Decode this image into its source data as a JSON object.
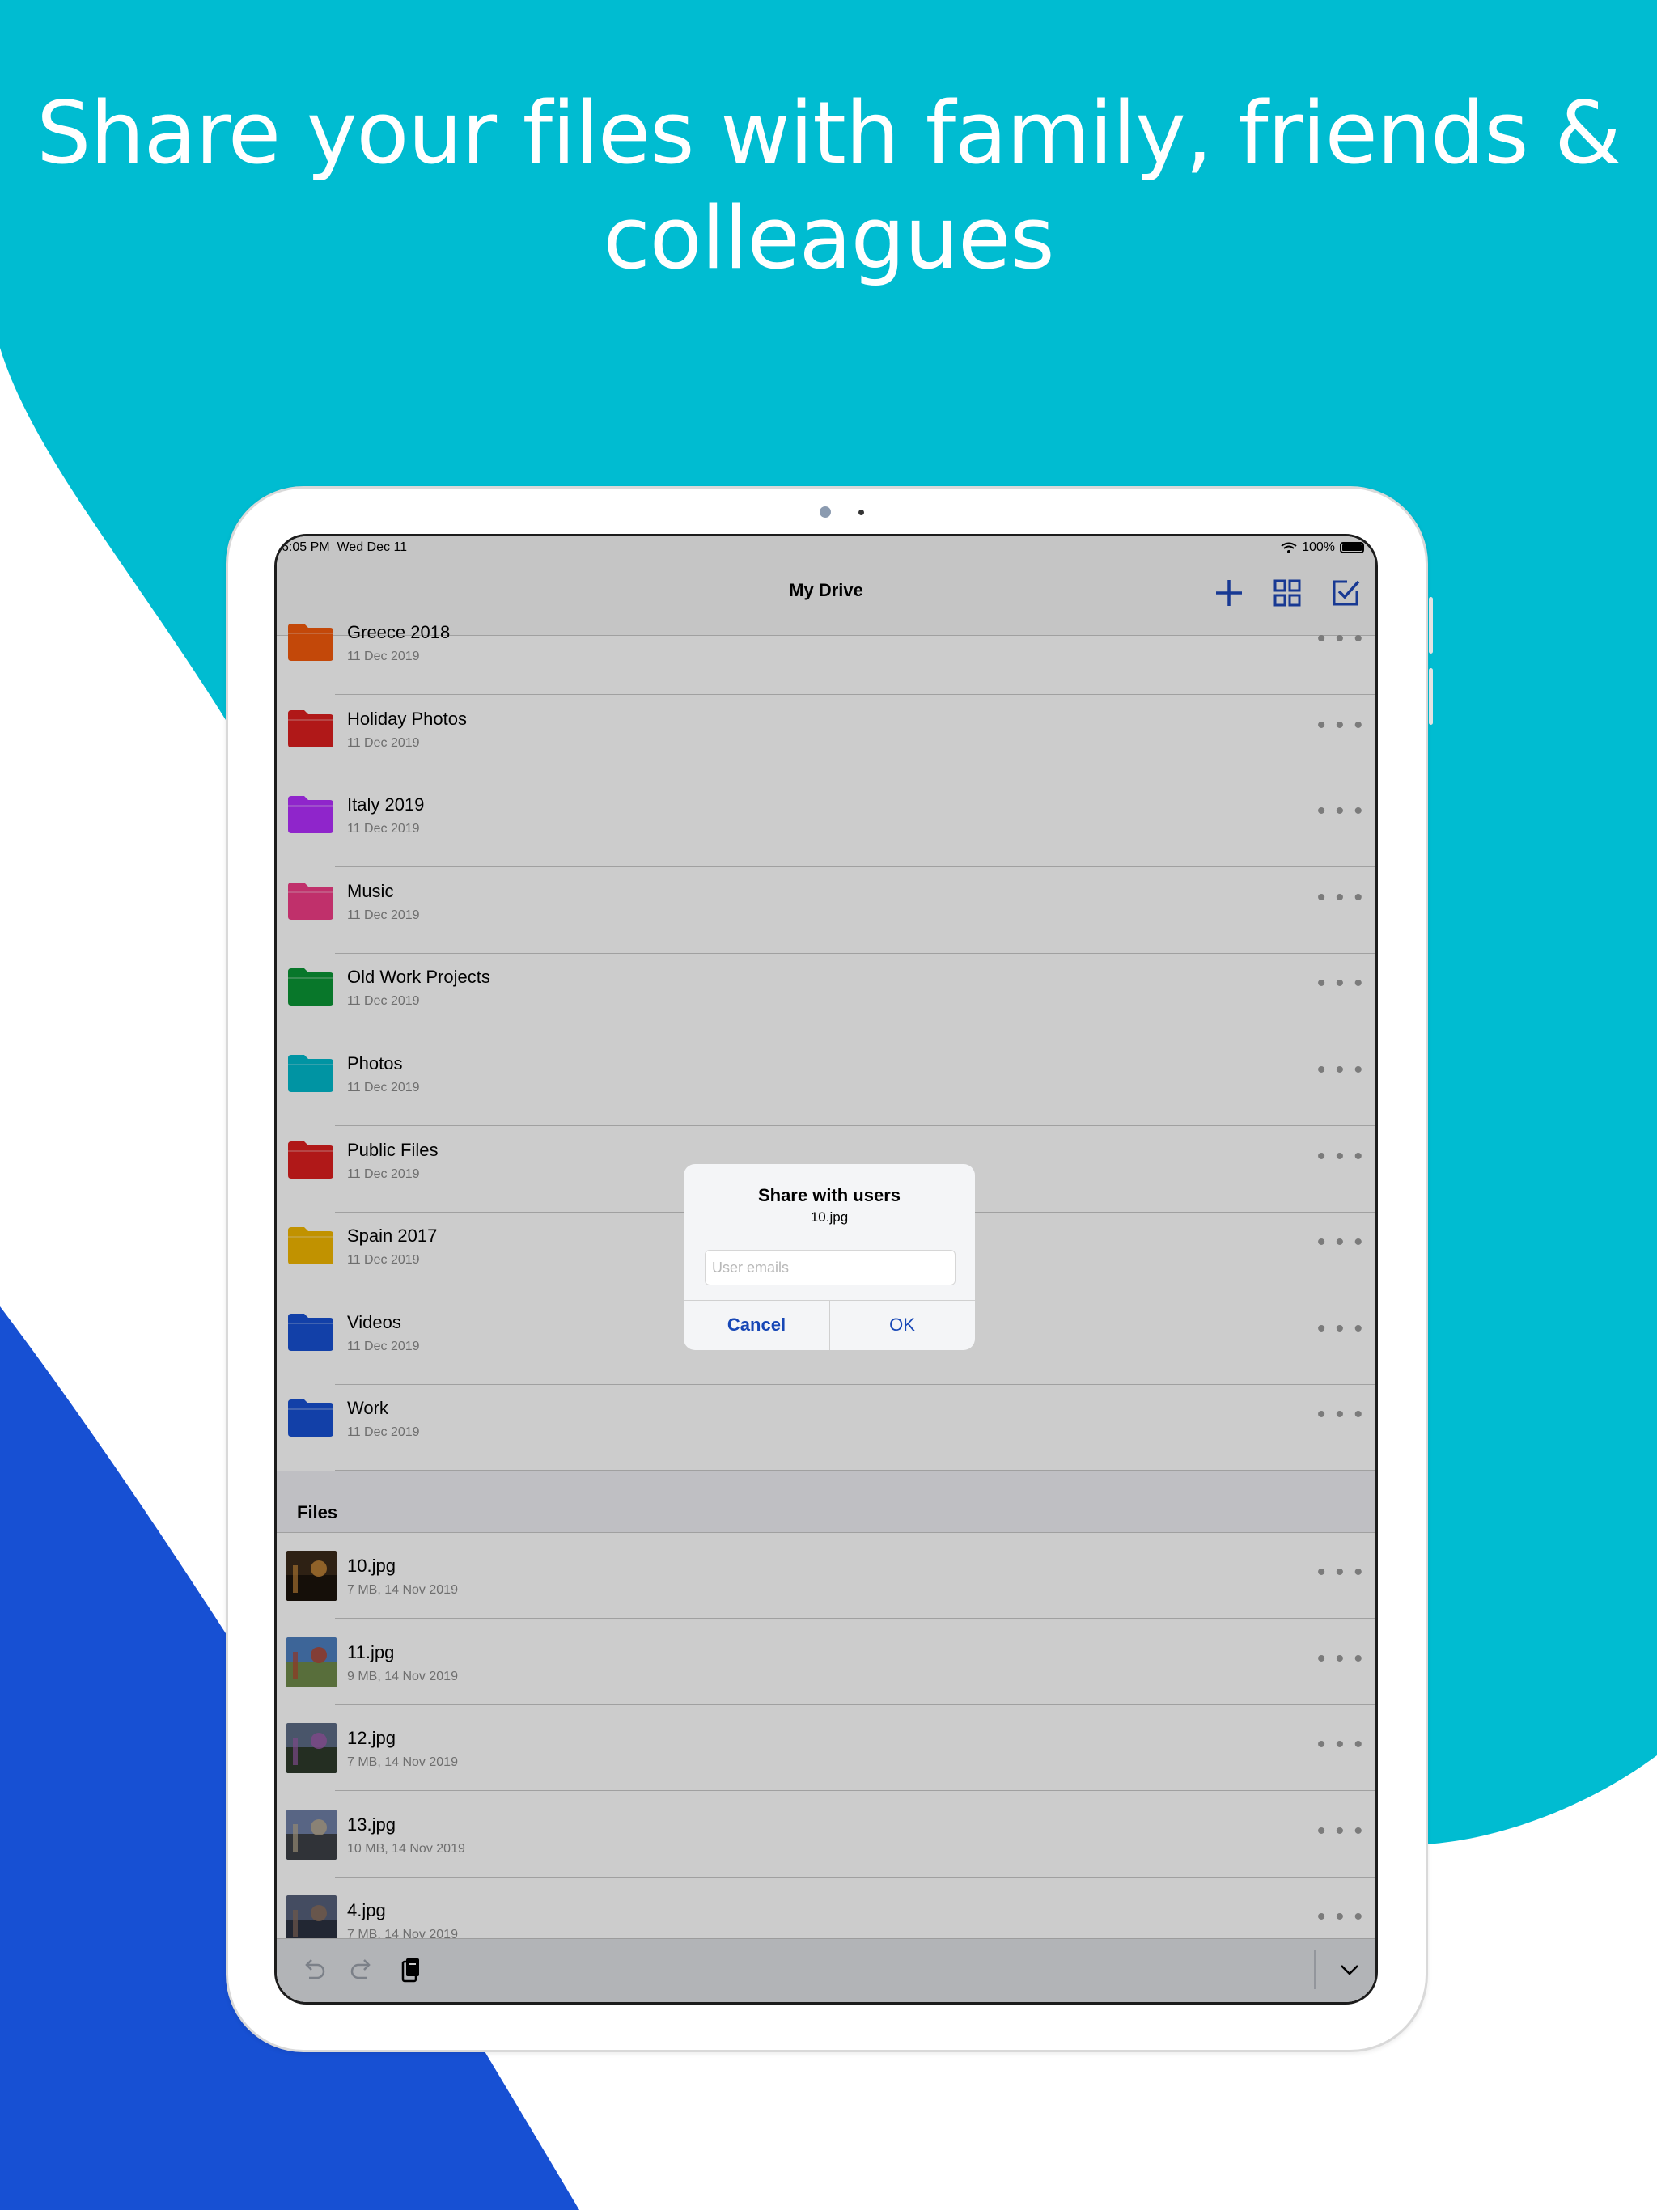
{
  "headline": {
    "line1": "Share your files with family, friends &",
    "line2": "colleagues"
  },
  "colors": {
    "teal": "#00bcd1",
    "blue": "#1750d3",
    "accent": "#1f48b8",
    "dim_overlay": "rgba(0,0,0,0.2)"
  },
  "status_bar": {
    "time": "6:05 PM",
    "date": "Wed Dec 11",
    "battery": "100%",
    "icons": [
      "wifi-icon",
      "battery-icon"
    ]
  },
  "nav": {
    "title": "My Drive",
    "icons": [
      "add-icon",
      "grid-view-icon",
      "select-icon"
    ]
  },
  "folders": [
    {
      "name": "Greece 2018",
      "date": "11 Dec 2019",
      "color": "#f45a0c"
    },
    {
      "name": "Holiday Photos",
      "date": "11 Dec 2019",
      "color": "#dd1f1f"
    },
    {
      "name": "Italy 2019",
      "date": "11 Dec 2019",
      "color": "#b32ffe"
    },
    {
      "name": "Music",
      "date": "11 Dec 2019",
      "color": "#f03c86"
    },
    {
      "name": "Old Work Projects",
      "date": "11 Dec 2019",
      "color": "#0b9535"
    },
    {
      "name": "Photos",
      "date": "11 Dec 2019",
      "color": "#00b9cc"
    },
    {
      "name": "Public Files",
      "date": "11 Dec 2019",
      "color": "#dd1f1f"
    },
    {
      "name": "Spain 2017",
      "date": "11 Dec 2019",
      "color": "#f2b700"
    },
    {
      "name": "Videos",
      "date": "11 Dec 2019",
      "color": "#1750d3"
    },
    {
      "name": "Work",
      "date": "11 Dec 2019",
      "color": "#1750d3"
    }
  ],
  "files_header": "Files",
  "files": [
    {
      "name": "10.jpg",
      "meta": "7 MB, 14 Nov 2019"
    },
    {
      "name": "11.jpg",
      "meta": "9 MB, 14 Nov 2019"
    },
    {
      "name": "12.jpg",
      "meta": "7 MB, 14 Nov 2019"
    },
    {
      "name": "13.jpg",
      "meta": "10 MB, 14 Nov 2019"
    },
    {
      "name": "4.jpg",
      "meta": "7 MB, 14 Nov 2019"
    }
  ],
  "row_more_label": "• • •",
  "toolbar": {
    "icons": [
      "undo-icon",
      "redo-icon",
      "clipboard-icon",
      "chevron-down-icon"
    ]
  },
  "dialog": {
    "title": "Share with users",
    "subtitle": "10.jpg",
    "input_placeholder": "User emails",
    "input_value": "",
    "cancel_label": "Cancel",
    "ok_label": "OK"
  }
}
